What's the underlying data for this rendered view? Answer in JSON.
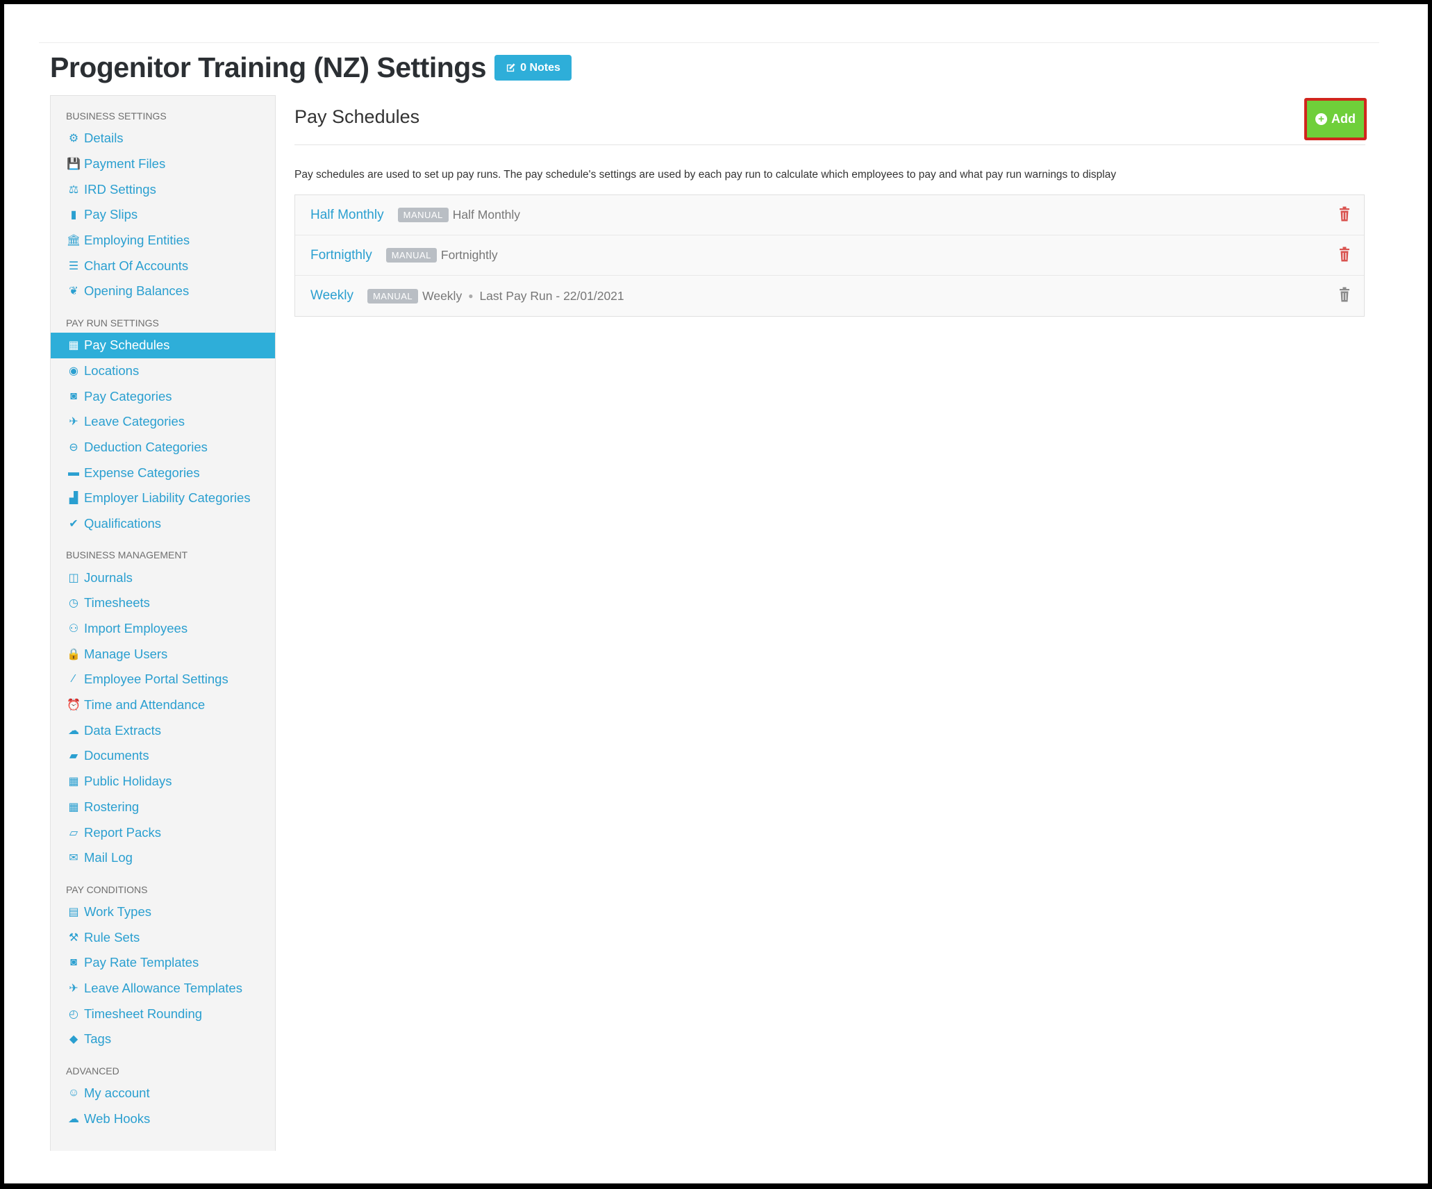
{
  "page": {
    "title": "Progenitor Training (NZ) Settings",
    "notes_label": "0 Notes"
  },
  "sidebar": {
    "sections": [
      {
        "title": "BUSINESS SETTINGS",
        "items": [
          {
            "label": "Details",
            "icon": "gear-icon"
          },
          {
            "label": "Payment Files",
            "icon": "save-icon"
          },
          {
            "label": "IRD Settings",
            "icon": "scales-icon"
          },
          {
            "label": "Pay Slips",
            "icon": "file-icon"
          },
          {
            "label": "Employing Entities",
            "icon": "bank-icon"
          },
          {
            "label": "Chart Of Accounts",
            "icon": "list-icon"
          },
          {
            "label": "Opening Balances",
            "icon": "leaf-icon"
          }
        ]
      },
      {
        "title": "PAY RUN SETTINGS",
        "items": [
          {
            "label": "Pay Schedules",
            "icon": "calendar-icon",
            "active": true
          },
          {
            "label": "Locations",
            "icon": "globe-icon"
          },
          {
            "label": "Pay Categories",
            "icon": "money-icon"
          },
          {
            "label": "Leave Categories",
            "icon": "plane-icon"
          },
          {
            "label": "Deduction Categories",
            "icon": "minus-circle-icon"
          },
          {
            "label": "Expense Categories",
            "icon": "archive-icon"
          },
          {
            "label": "Employer Liability Categories",
            "icon": "industry-icon"
          },
          {
            "label": "Qualifications",
            "icon": "check-icon"
          }
        ]
      },
      {
        "title": "BUSINESS MANAGEMENT",
        "items": [
          {
            "label": "Journals",
            "icon": "columns-icon"
          },
          {
            "label": "Timesheets",
            "icon": "clock-icon"
          },
          {
            "label": "Import Employees",
            "icon": "people-icon"
          },
          {
            "label": "Manage Users",
            "icon": "lock-icon"
          },
          {
            "label": "Employee Portal Settings",
            "icon": "wand-icon"
          },
          {
            "label": "Time and Attendance",
            "icon": "alarm-icon"
          },
          {
            "label": "Data Extracts",
            "icon": "cloud-download-icon"
          },
          {
            "label": "Documents",
            "icon": "folder-icon"
          },
          {
            "label": "Public Holidays",
            "icon": "calendar-icon"
          },
          {
            "label": "Rostering",
            "icon": "calendar-grid-icon"
          },
          {
            "label": "Report Packs",
            "icon": "folder-open-icon"
          },
          {
            "label": "Mail Log",
            "icon": "envelope-icon"
          }
        ]
      },
      {
        "title": "PAY CONDITIONS",
        "items": [
          {
            "label": "Work Types",
            "icon": "book-icon"
          },
          {
            "label": "Rule Sets",
            "icon": "gavel-icon"
          },
          {
            "label": "Pay Rate Templates",
            "icon": "money-icon"
          },
          {
            "label": "Leave Allowance Templates",
            "icon": "plane-icon"
          },
          {
            "label": "Timesheet Rounding",
            "icon": "clock-outline-icon"
          },
          {
            "label": "Tags",
            "icon": "tag-icon"
          }
        ]
      },
      {
        "title": "ADVANCED",
        "items": [
          {
            "label": "My account",
            "icon": "user-circle-icon"
          },
          {
            "label": "Web Hooks",
            "icon": "cloud-icon"
          }
        ]
      }
    ]
  },
  "main": {
    "title": "Pay Schedules",
    "add_label": "Add",
    "description": "Pay schedules are used to set up pay runs. The pay schedule's settings are used by each pay run to calculate which employees to pay and what pay run warnings to display",
    "schedules": [
      {
        "name": "Half Monthly",
        "badge": "MANUAL",
        "frequency": "Half Monthly",
        "last_run": "",
        "trash_color": "#d9534f"
      },
      {
        "name": "Fortnigthly",
        "badge": "MANUAL",
        "frequency": "Fortnightly",
        "last_run": "",
        "trash_color": "#d9534f"
      },
      {
        "name": "Weekly",
        "badge": "MANUAL",
        "frequency": "Weekly",
        "last_run": "Last Pay Run - 22/01/2021",
        "trash_color": "#8a8a8a"
      }
    ]
  }
}
